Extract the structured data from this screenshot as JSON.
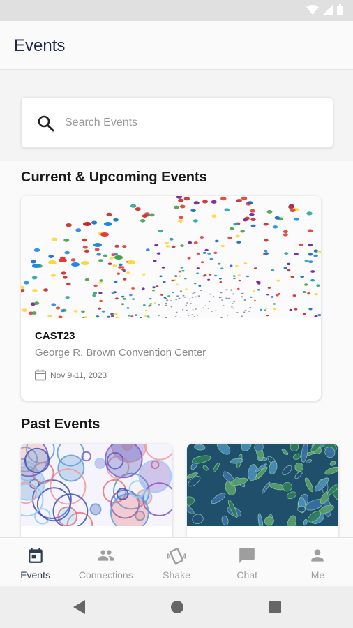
{
  "header": {
    "title": "Events"
  },
  "search": {
    "placeholder": "Search Events"
  },
  "current_section": {
    "title": "Current & Upcoming Events"
  },
  "current_events": [
    {
      "name": "CAST23",
      "venue": "George R. Brown Convention Center",
      "date": "Nov  9-11, 2023"
    }
  ],
  "past_section": {
    "title": "Past Events"
  },
  "nav": {
    "items": [
      {
        "label": "Events",
        "icon": "calendar-icon",
        "active": true
      },
      {
        "label": "Connections",
        "icon": "people-icon",
        "active": false
      },
      {
        "label": "Shake",
        "icon": "shake-icon",
        "active": false
      },
      {
        "label": "Chat",
        "icon": "chat-icon",
        "active": false
      },
      {
        "label": "Me",
        "icon": "person-icon",
        "active": false
      }
    ]
  },
  "colors": {
    "active_nav": "#2c3e50",
    "inactive_nav": "#9e9e9e",
    "title": "#1f2a44"
  }
}
